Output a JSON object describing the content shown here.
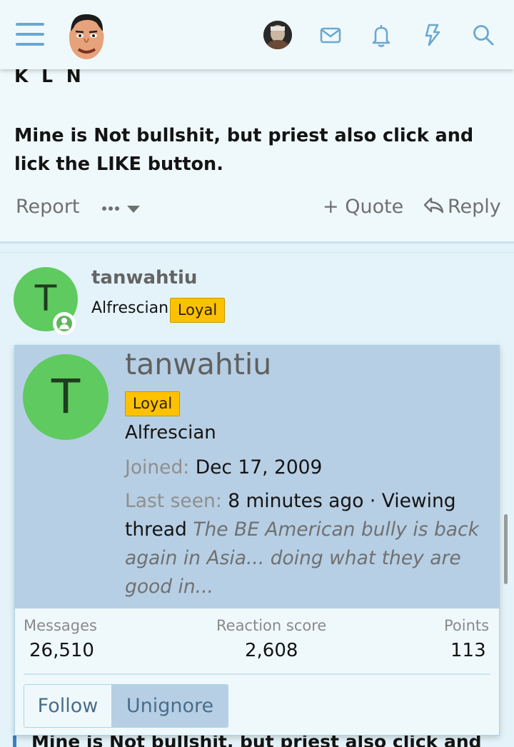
{
  "header": {
    "menu_icon": "hamburger-icon",
    "icons": [
      "inbox-icon",
      "bell-icon",
      "bolt-icon",
      "search-icon"
    ]
  },
  "post1": {
    "signature": "K L N",
    "body": "Mine is Not bullshit, but priest also click and lick the LIKE button.",
    "actions": {
      "report": "Report",
      "more": "•••",
      "quote": "+ Quote",
      "reply": "Reply"
    }
  },
  "post2": {
    "avatar_letter": "T",
    "username": "tanwahtiu",
    "user_title": "Alfrescian",
    "banner": "Loyal"
  },
  "member_card": {
    "avatar_letter": "T",
    "username": "tanwahtiu",
    "banner": "Loyal",
    "user_title": "Alfrescian",
    "joined_label": "Joined:",
    "joined_value": "Dec 17, 2009",
    "last_seen_label": "Last seen:",
    "last_seen_value": "8 minutes ago · Viewing thread",
    "viewing_thread": "The BE American bully is back again in Asia... doing what they are good in...",
    "stats": {
      "messages_label": "Messages",
      "messages_value": "26,510",
      "reaction_label": "Reaction score",
      "reaction_value": "2,608",
      "points_label": "Points",
      "points_value": "113"
    },
    "buttons": {
      "follow": "Follow",
      "unignore": "Unignore"
    }
  },
  "post2_body_partial": "Mine is Not bullshit, but priest also click and",
  "colors": {
    "accent": "#6ba8d0",
    "avatar_green": "#5fca5f",
    "banner_yellow": "#fdc100",
    "card_header": "#b7cfe4"
  }
}
